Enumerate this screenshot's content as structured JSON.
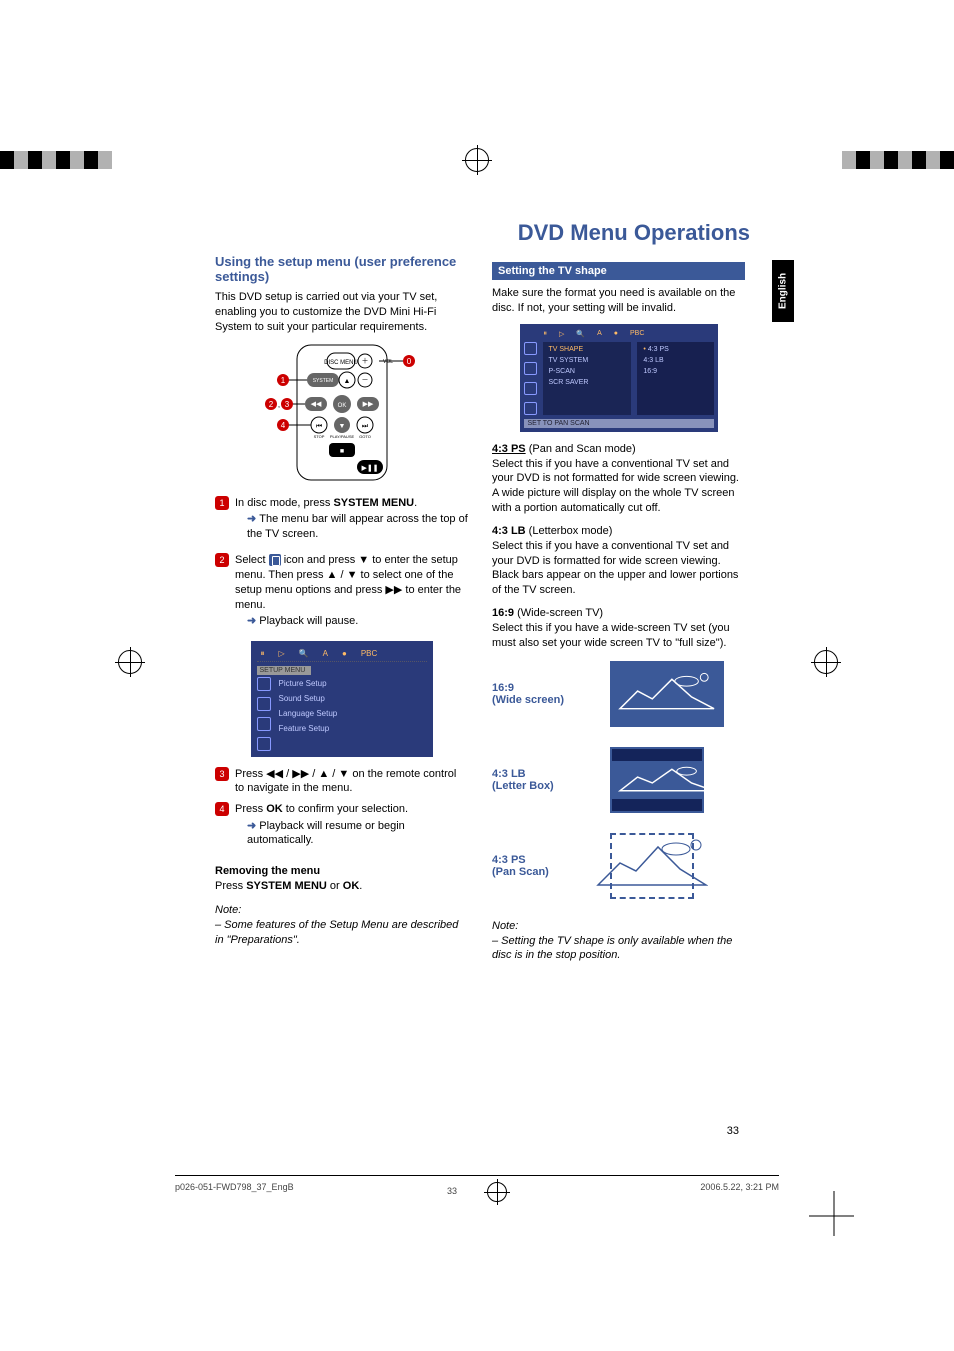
{
  "page_title": "DVD Menu Operations",
  "lang_tab": "English",
  "page_number": "33",
  "footer": {
    "left": "p026-051-FWD798_37_EngB",
    "mid": "33",
    "right": "2006.5.22, 3:21 PM"
  },
  "left": {
    "heading": "Using the setup menu (user preference settings)",
    "intro": "This DVD setup is carried out via your TV set, enabling you to customize the DVD Mini Hi-Fi System to suit your particular requirements.",
    "steps": {
      "s1_a": "In disc mode, press ",
      "s1_b": "SYSTEM MENU",
      "s1_c": ".",
      "s1_res": "The menu bar will appear across the top of the TV screen.",
      "s2_a": "Select ",
      "s2_b": " icon and press ▼ to enter the setup menu. Then press ▲ / ▼  to select one of the setup menu options and press ▶▶ to enter the menu.",
      "s2_res": "Playback will pause.",
      "s3": "Press  ◀◀ / ▶▶ /  ▲  /  ▼ on the remote control to navigate in the menu.",
      "s4_a": "Press ",
      "s4_b": "OK",
      "s4_c": " to confirm your selection.",
      "s4_res": "Playback will resume or begin automatically."
    },
    "remove_head": "Removing the menu",
    "remove_body_a": "Press ",
    "remove_body_b": "SYSTEM MENU",
    "remove_body_c": " or ",
    "remove_body_d": "OK",
    "remove_body_e": ".",
    "note_head": "Note:",
    "note_body": "–   Some features of the Setup Menu are described in \"Preparations\".",
    "osd1": {
      "setup_label": "SETUP MENU",
      "items": [
        "Picture Setup",
        "Sound Setup",
        "Language Setup",
        "Feature Setup"
      ],
      "top_icons": [
        "⏸",
        "▷",
        "🔍",
        "A",
        "●",
        "PBC"
      ]
    }
  },
  "right": {
    "box_head": "Setting the TV shape",
    "intro": "Make sure the format you need is available on the disc. If not, your setting will be invalid.",
    "osd2": {
      "top_icons": [
        "⏸",
        "▷",
        "🔍",
        "A",
        "●",
        "PBC"
      ],
      "mid": [
        "TV SHAPE",
        "TV SYSTEM",
        "P-SCAN",
        "SCR SAVER"
      ],
      "right": [
        "4:3 PS",
        "4:3 LB",
        "16:9"
      ],
      "foot": "SET TO PAN SCAN"
    },
    "ps_head": "4:3 PS",
    "ps_mode": " (Pan and Scan mode)",
    "ps_body": "Select this if you have a conventional TV set and your DVD is not formatted for wide screen viewing. A wide picture will display on the whole TV screen with a portion automatically cut off.",
    "lb_head": "4:3 LB",
    "lb_mode": " (Letterbox mode)",
    "lb_body": "Select this if you have a conventional TV set and your DVD is formatted for wide screen viewing. Black bars appear on the upper and lower portions of the TV screen.",
    "w_head": "16:9",
    "w_mode": " (Wide-screen TV)",
    "w_body": "Select this if you have a wide-screen TV set (you must also set your wide screen TV to \"full size\").",
    "illus": {
      "w": "16:9\n(Wide screen)",
      "lb": "4:3 LB\n(Letter Box)",
      "ps": "4:3 PS\n(Pan Scan)"
    },
    "note_head": "Note:",
    "note_body": "–   Setting the TV shape is only available when the disc is in the stop position."
  }
}
